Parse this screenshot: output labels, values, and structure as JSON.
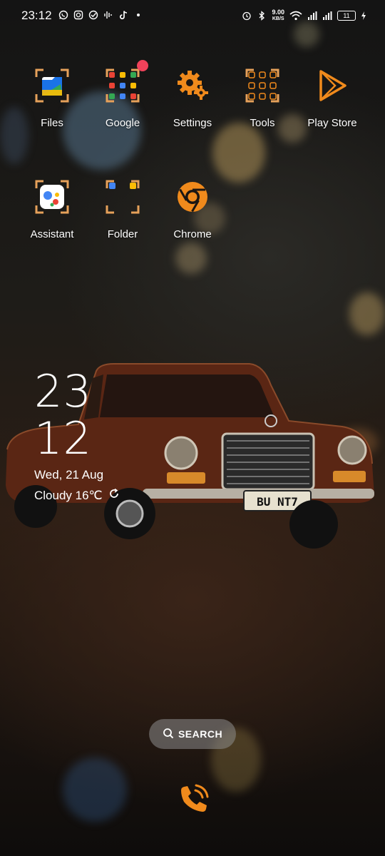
{
  "status_bar": {
    "time": "23:12",
    "left_icons": [
      "whatsapp-icon",
      "instagram-icon",
      "check-circle-icon",
      "voice-wave-icon",
      "tiktok-icon",
      "dot-icon"
    ],
    "speed_value": "9.00",
    "speed_unit": "KB/S",
    "battery": "11"
  },
  "apps": [
    {
      "label": "Files",
      "icon": "files-icon"
    },
    {
      "label": "Google",
      "icon": "google-folder-icon",
      "badge": true
    },
    {
      "label": "Settings",
      "icon": "settings-gear-icon"
    },
    {
      "label": "Tools",
      "icon": "tools-folder-icon"
    },
    {
      "label": "Play Store",
      "icon": "play-store-icon"
    },
    {
      "label": "Assistant",
      "icon": "assistant-icon"
    },
    {
      "label": "Folder",
      "icon": "folder-icon"
    },
    {
      "label": "Chrome",
      "icon": "chrome-icon"
    }
  ],
  "clock_widget": {
    "hours": "23",
    "minutes": "12",
    "date": "Wed, 21 Aug",
    "weather": "Cloudy 16℃"
  },
  "search": {
    "label": "SEARCH"
  },
  "wallpaper": {
    "plate_text": "BU NT7"
  },
  "colors": {
    "accent": "#f08a1c",
    "badge": "#f0425a"
  }
}
